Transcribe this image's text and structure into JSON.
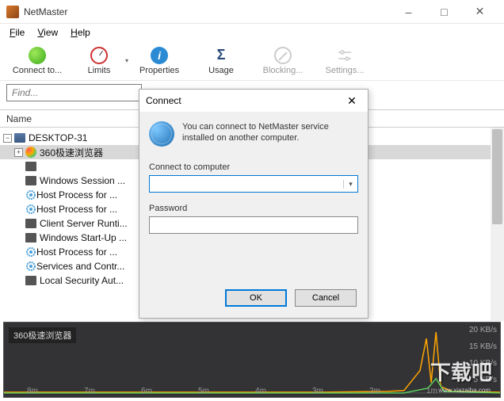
{
  "window": {
    "title": "NetMaster"
  },
  "menu": {
    "file": "File",
    "view": "View",
    "help": "Help"
  },
  "toolbar": {
    "connect": "Connect to...",
    "limits": "Limits",
    "properties": "Properties",
    "usage": "Usage",
    "blocking": "Blocking...",
    "settings": "Settings..."
  },
  "findbar": {
    "placeholder": "Find..."
  },
  "tree": {
    "header": "Name",
    "root": "DESKTOP-31",
    "items": [
      "360极速浏览器",
      "",
      "Windows Session ...",
      "Host Process for ...",
      "Host Process for ...",
      "Client Server Runti...",
      "Windows Start-Up ...",
      "Host Process for ...",
      "Services and Contr...",
      "Local Security Aut..."
    ]
  },
  "graph": {
    "label": "360极速浏览器",
    "x": [
      "8m",
      "7m",
      "6m",
      "5m",
      "4m",
      "3m",
      "2m",
      "1m"
    ],
    "y": [
      "20 KB/s",
      "15 KB/s",
      "10 KB/s",
      "5 KB/s"
    ]
  },
  "watermark": {
    "main": "下载吧",
    "sub": "www.xiazaiba.com"
  },
  "dialog": {
    "title": "Connect",
    "info": "You can connect to NetMaster service installed on another computer.",
    "computer_label": "Connect to computer",
    "password_label": "Password",
    "ok": "OK",
    "cancel": "Cancel"
  }
}
